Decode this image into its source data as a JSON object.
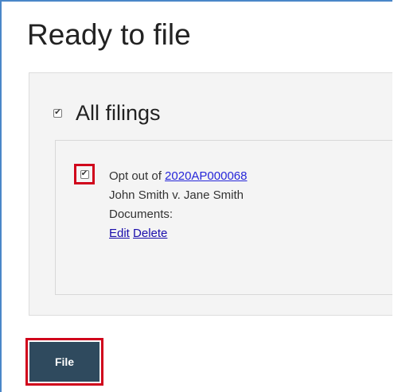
{
  "page": {
    "title": "Ready to file"
  },
  "all_filings": {
    "label": "All filings",
    "checked": true
  },
  "filing": {
    "checked": true,
    "opt_out_prefix": "Opt out of ",
    "case_number": "2020AP000068",
    "case_name": "John Smith v. Jane Smith",
    "documents_label": "Documents:",
    "edit_label": "Edit",
    "delete_label": "Delete"
  },
  "actions": {
    "file_label": "File"
  },
  "colors": {
    "button_bg": "#2f4a5e",
    "highlight_border": "#d0021b",
    "link": "#1a0dab"
  }
}
